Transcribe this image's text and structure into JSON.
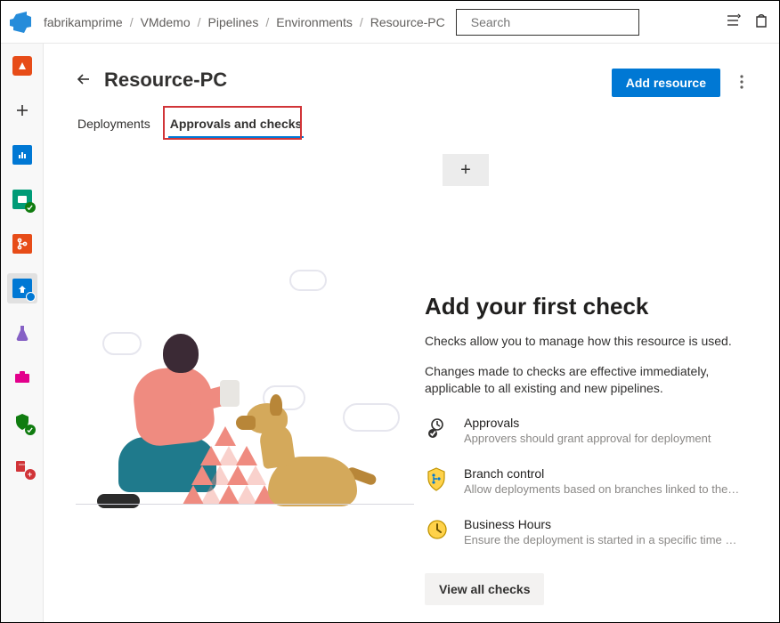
{
  "header": {
    "breadcrumbs": [
      "fabrikamprime",
      "VMdemo",
      "Pipelines",
      "Environments",
      "Resource-PC"
    ],
    "search_placeholder": "Search"
  },
  "page": {
    "title": "Resource-PC",
    "primary_button": "Add resource"
  },
  "tabs": [
    {
      "label": "Deployments",
      "active": false
    },
    {
      "label": "Approvals and checks",
      "active": true
    }
  ],
  "empty_state": {
    "title": "Add your first check",
    "desc1": "Checks allow you to manage how this resource is used.",
    "desc2": "Changes made to checks are effective immediately, applicable to all existing and new pipelines.",
    "items": [
      {
        "title": "Approvals",
        "sub": "Approvers should grant approval for deployment"
      },
      {
        "title": "Branch control",
        "sub": "Allow deployments based on branches linked to the run"
      },
      {
        "title": "Business Hours",
        "sub": "Ensure the deployment is started in a specific time win…"
      }
    ],
    "view_all": "View all checks"
  }
}
